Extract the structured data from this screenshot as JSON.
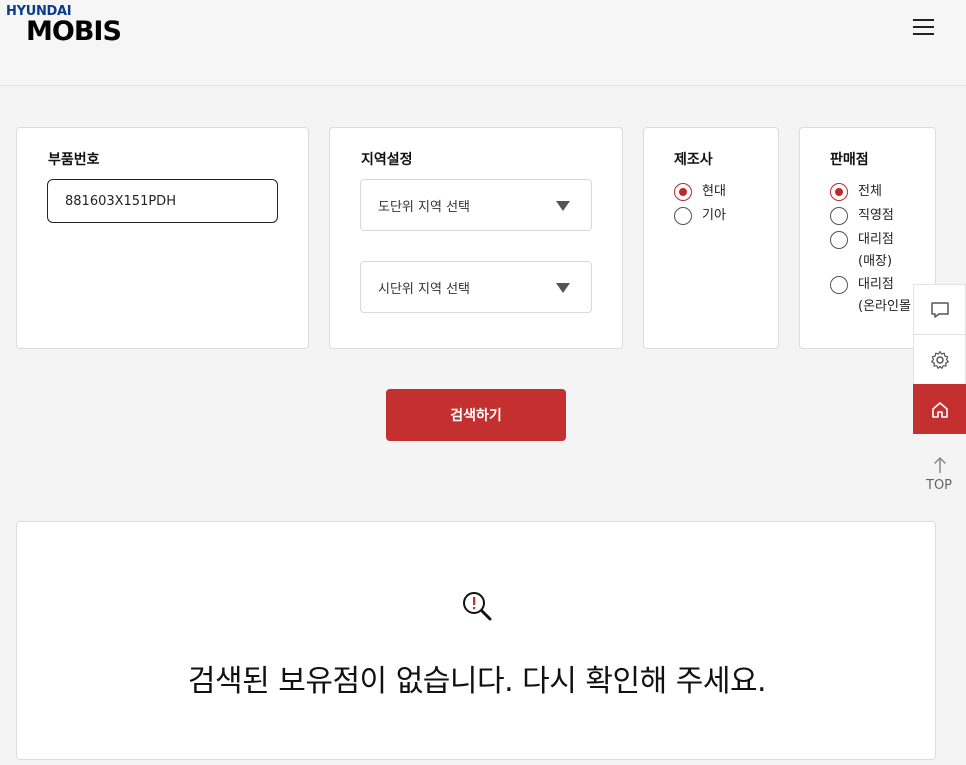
{
  "header": {
    "logo_top": "HYUNDAI",
    "logo_main": "MOBIS",
    "menu_icon": "hamburger-menu-icon"
  },
  "filters": {
    "part_number": {
      "title": "부품번호",
      "value": "881603X151PDH"
    },
    "region": {
      "title": "지역설정",
      "province_placeholder": "도단위 지역 선택",
      "city_placeholder": "시단위 지역 선택"
    },
    "manufacturer": {
      "title": "제조사",
      "options": [
        {
          "label": "현대",
          "selected": true
        },
        {
          "label": "기아",
          "selected": false
        }
      ]
    },
    "dealer": {
      "title": "판매점",
      "options": [
        {
          "label": "전체",
          "selected": true
        },
        {
          "label": "직영점",
          "selected": false
        },
        {
          "label": "대리점",
          "sub": "(매장)",
          "selected": false
        },
        {
          "label": "대리점",
          "sub": "(온라인몰",
          "selected": false
        }
      ]
    }
  },
  "search_button": {
    "label": "검색하기"
  },
  "side_panel": {
    "items": [
      "chat-icon",
      "gear-icon",
      "home-icon"
    ],
    "top_label": "TOP"
  },
  "result": {
    "icon": "magnifier-alert-icon",
    "message": "검색된 보유점이 없습니다. 다시 확인해 주세요."
  },
  "colors": {
    "accent": "#c3302f",
    "logo_blue": "#0b3c8c"
  }
}
